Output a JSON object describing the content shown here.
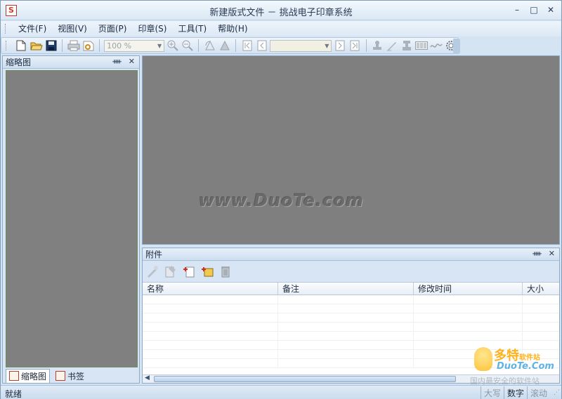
{
  "window": {
    "title": "新建版式文件 － 挑战电子印章系统",
    "icon_letter": "S",
    "controls": {
      "minimize": "–",
      "maximize": "□",
      "close": "✕"
    }
  },
  "menu": {
    "items": [
      {
        "label": "文件(F)"
      },
      {
        "label": "视图(V)"
      },
      {
        "label": "页面(P)"
      },
      {
        "label": "印章(S)"
      },
      {
        "label": "工具(T)"
      },
      {
        "label": "帮助(H)"
      }
    ]
  },
  "toolbar": {
    "zoom_value": "100 %",
    "page_value": "",
    "icons": [
      "new-file-icon",
      "open-folder-icon",
      "save-icon",
      "print-icon",
      "print-preview-icon",
      "zoom-in-icon",
      "zoom-out-icon",
      "rotate-left-icon",
      "rotate-right-icon",
      "first-page-icon",
      "prev-page-icon",
      "next-page-icon",
      "last-page-icon",
      "stamp-icon",
      "signature-icon",
      "seal-verify-icon",
      "barcode-icon",
      "handwrite-icon",
      "settings-ring-icon"
    ]
  },
  "left_panel": {
    "title": "缩略图",
    "pin": "ᚓ",
    "close": "✕",
    "tabs": [
      {
        "label": "缩略图",
        "active": true
      },
      {
        "label": "书签",
        "active": false
      }
    ]
  },
  "main_view": {
    "watermark": "www.DuoTe.com"
  },
  "attachments": {
    "title": "附件",
    "pin": "ᚓ",
    "close": "✕",
    "columns": [
      {
        "label": "名称"
      },
      {
        "label": "备注"
      },
      {
        "label": "修改时间"
      },
      {
        "label": "大小"
      }
    ],
    "rows": []
  },
  "statusbar": {
    "text": "就绪",
    "indicators": [
      {
        "label": "大写",
        "on": false
      },
      {
        "label": "数字",
        "on": true
      },
      {
        "label": "滚动",
        "on": false
      }
    ]
  },
  "corner_logo": {
    "cn": "多特",
    "cn_small": "软件站",
    "en": "DuoTe.Com",
    "slogan": "国内最安全的软件站"
  }
}
